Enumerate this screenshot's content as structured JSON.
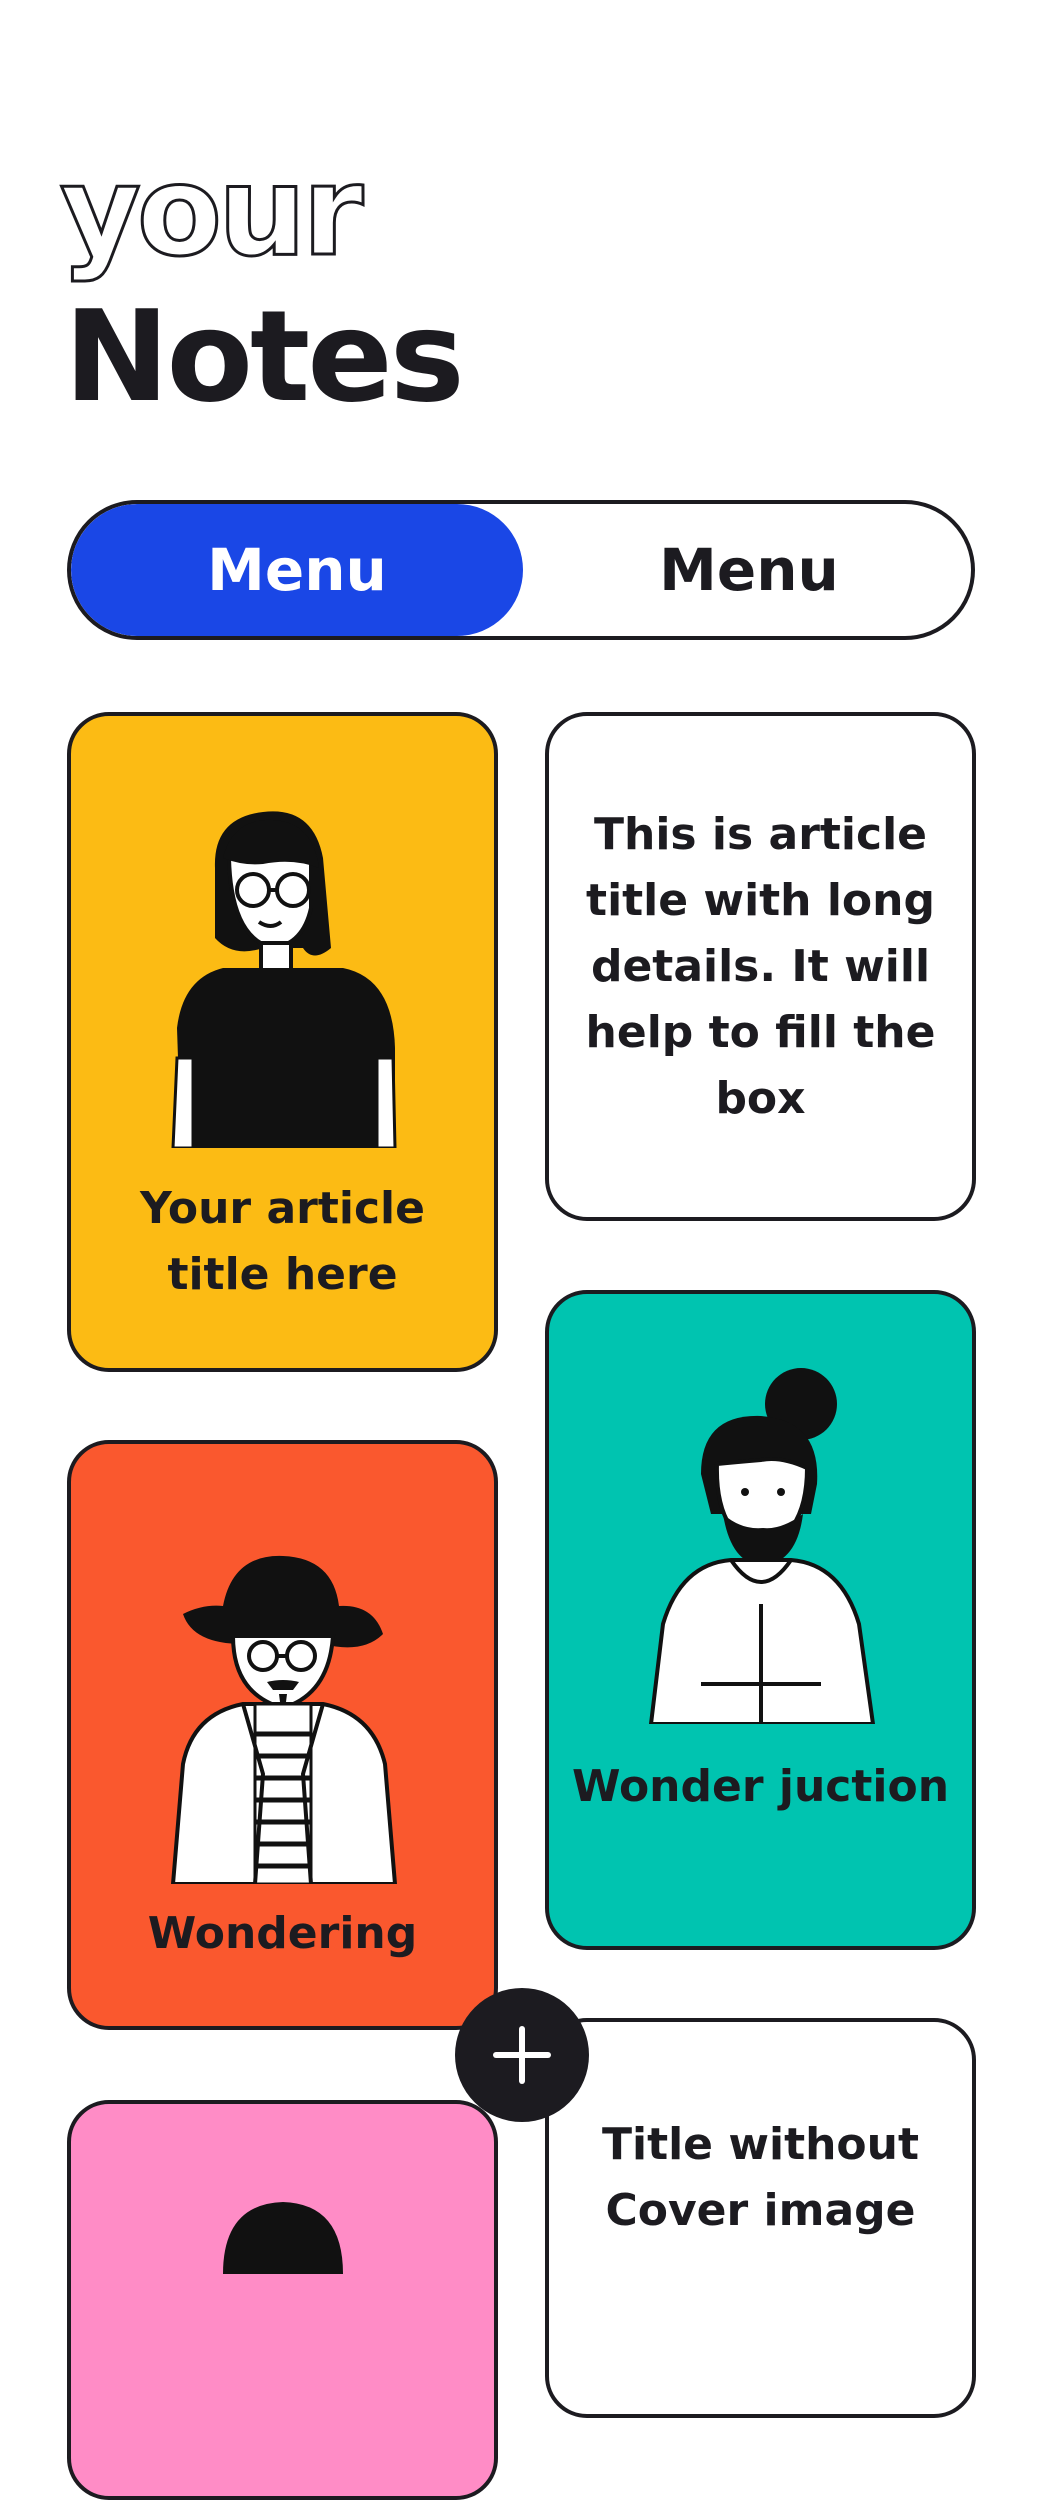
{
  "header": {
    "subtitle": "your",
    "title": "Notes"
  },
  "segmented": {
    "left_label": "Menu",
    "right_label": "Menu",
    "active": "left"
  },
  "colors": {
    "accent": "#1a47e6",
    "yellow": "#fcbb14",
    "orange": "#fa582e",
    "teal": "#00c4b0",
    "pink": "#ff8cc6",
    "ink": "#1c1b20"
  },
  "cards": [
    {
      "title": "Your article title here",
      "color": "#fcbb14",
      "illustration": "woman-with-glasses-avatar"
    },
    {
      "title": "This is article title with long details. It will help to fill the box",
      "color": "#ffffff"
    },
    {
      "title": "Wondering",
      "color": "#fa582e",
      "illustration": "man-with-hat-avatar"
    },
    {
      "title": "Wonder juction",
      "color": "#00c4b0",
      "illustration": "man-with-bun-avatar"
    },
    {
      "title": "Title without Cover image",
      "color": "#ffffff"
    },
    {
      "title": "",
      "color": "#ff8cc6",
      "illustration": "woman-avatar"
    }
  ],
  "fab": {
    "icon": "plus-icon"
  }
}
